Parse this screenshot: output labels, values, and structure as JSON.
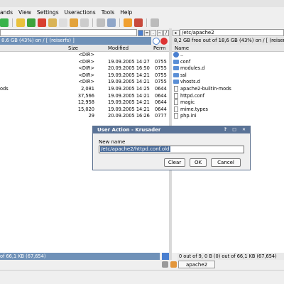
{
  "menu": [
    "ands",
    "View",
    "Settings",
    "Useractions",
    "Tools",
    "Help"
  ],
  "toolbar_icons": [
    "new-icon",
    "copy-icon",
    "ok-icon",
    "delete-icon",
    "move-icon",
    "view-icon",
    "edit-icon",
    "mkdir-icon",
    "search-icon",
    "sync-icon",
    "terminal-icon",
    "user-icon",
    "settings-icon"
  ],
  "left": {
    "status": "8.6 GB (43%) on / [ (reiserfs) ]",
    "columns": {
      "size": "Size",
      "modified": "Modified",
      "perm": "Perm"
    },
    "rows": [
      {
        "name": "",
        "size": "<DIR>",
        "modified": "",
        "perm": ""
      },
      {
        "name": "",
        "size": "<DIR>",
        "modified": "19.09.2005 14:27",
        "perm": "0755"
      },
      {
        "name": "",
        "size": "<DIR>",
        "modified": "20.09.2005 16:50",
        "perm": "0755"
      },
      {
        "name": "",
        "size": "<DIR>",
        "modified": "19.09.2005 14:21",
        "perm": "0755"
      },
      {
        "name": "",
        "size": "<DIR>",
        "modified": "19.09.2005 14:21",
        "perm": "0755"
      },
      {
        "name": "ods",
        "size": "2,081",
        "modified": "19.09.2005 14:25",
        "perm": "0644"
      },
      {
        "name": "",
        "size": "37,566",
        "modified": "19.09.2005 14:21",
        "perm": "0644"
      },
      {
        "name": "",
        "size": "12,958",
        "modified": "19.09.2005 14:21",
        "perm": "0644"
      },
      {
        "name": "",
        "size": "15,020",
        "modified": "19.09.2005 14:21",
        "perm": "0644"
      },
      {
        "name": "",
        "size": "29",
        "modified": "20.09.2005 16:26",
        "perm": "0777"
      }
    ],
    "footer": "of 66,1 KB (67,654)"
  },
  "right": {
    "path": "/etc/apache2",
    "status": "8,2 GB free out of 18,6 GB (43%) on / [ (reiserfs) ]",
    "columns": {
      "name": "Name"
    },
    "rows": [
      {
        "name": "..",
        "kind": "up"
      },
      {
        "name": "conf",
        "kind": "folder"
      },
      {
        "name": "modules.d",
        "kind": "folder"
      },
      {
        "name": "ssl",
        "kind": "folder"
      },
      {
        "name": "vhosts.d",
        "kind": "folder"
      },
      {
        "name": "apache2-builtin-mods",
        "kind": "file"
      },
      {
        "name": "httpd.conf",
        "kind": "file"
      },
      {
        "name": "magic",
        "kind": "file"
      },
      {
        "name": "mime.types",
        "kind": "file"
      },
      {
        "name": "php.ini",
        "kind": "file"
      }
    ],
    "footer": "0 out of 9, 0 B (0) out of 66,1 KB (67,654)",
    "tab": "apache2"
  },
  "dialog": {
    "title": "User Action - Krusader",
    "controls": "? □ ✕",
    "label": "New name",
    "value": "/etc/apache2/httpd.conf.old",
    "buttons": [
      "Clear",
      "OK",
      "Cancel"
    ]
  },
  "colors": {
    "selection": "#6f91b8",
    "dialog_title": "#5a7397"
  }
}
